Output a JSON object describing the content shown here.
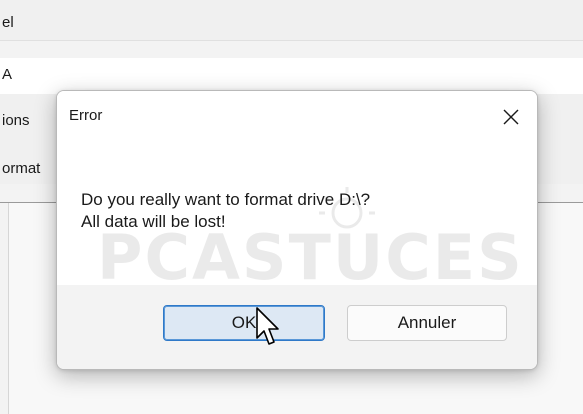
{
  "background_window": {
    "row1_text": "el",
    "row2_text": "A",
    "row3_text": "ions",
    "row4_text": "ormat"
  },
  "dialog": {
    "title": "Error",
    "close_icon": "close-icon",
    "message_line1": "Do you really want to format drive D:\\?",
    "message_line2": "All data will be lost!",
    "watermark_text": "PCASTUCES",
    "ok_label": "OK",
    "cancel_label": "Annuler"
  },
  "colors": {
    "dialog_bg": "#ffffff",
    "footer_bg": "#f3f3f3",
    "ok_button_bg": "#dde8f4",
    "ok_button_border": "#2f79c8",
    "cancel_button_bg": "#fbfbfb"
  },
  "icons": {
    "pointer": "mouse-pointer-hand-icon"
  }
}
